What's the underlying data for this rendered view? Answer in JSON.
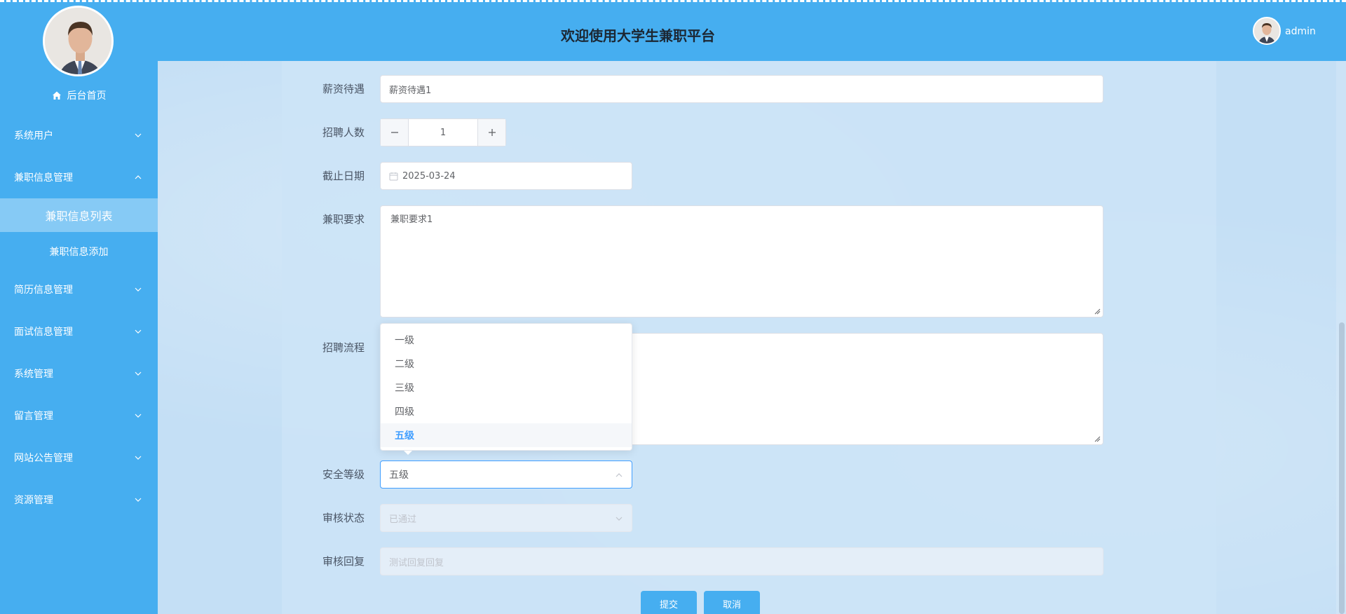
{
  "header": {
    "title": "欢迎使用大学生兼职平台",
    "username": "admin"
  },
  "sidebar": {
    "home": "后台首页",
    "menus": [
      {
        "label": "系统用户",
        "expanded": false
      },
      {
        "label": "兼职信息管理",
        "expanded": true
      },
      {
        "label": "简历信息管理",
        "expanded": false
      },
      {
        "label": "面试信息管理",
        "expanded": false
      },
      {
        "label": "系统管理",
        "expanded": false
      },
      {
        "label": "留言管理",
        "expanded": false
      },
      {
        "label": "网站公告管理",
        "expanded": false
      },
      {
        "label": "资源管理",
        "expanded": false
      }
    ],
    "submenus": [
      {
        "label": "兼职信息列表",
        "active": true
      },
      {
        "label": "兼职信息添加",
        "active": false
      }
    ]
  },
  "form": {
    "salary": {
      "label": "薪资待遇",
      "value": "薪资待遇1"
    },
    "headcount": {
      "label": "招聘人数",
      "value": "1"
    },
    "deadline": {
      "label": "截止日期",
      "value": "2025-03-24"
    },
    "requirement": {
      "label": "兼职要求",
      "value": "兼职要求1"
    },
    "process": {
      "label": "招聘流程",
      "value": ""
    },
    "security_level": {
      "label": "安全等级",
      "value": "五级",
      "options": [
        "一级",
        "二级",
        "三级",
        "四级",
        "五级"
      ]
    },
    "review_status": {
      "label": "审核状态",
      "value": "已通过"
    },
    "review_reply": {
      "label": "审核回复",
      "value": "测试回复回复"
    }
  },
  "buttons": {
    "submit": "提交",
    "cancel": "取消"
  },
  "colors": {
    "primary": "#46aef0",
    "accent": "#409eff"
  }
}
